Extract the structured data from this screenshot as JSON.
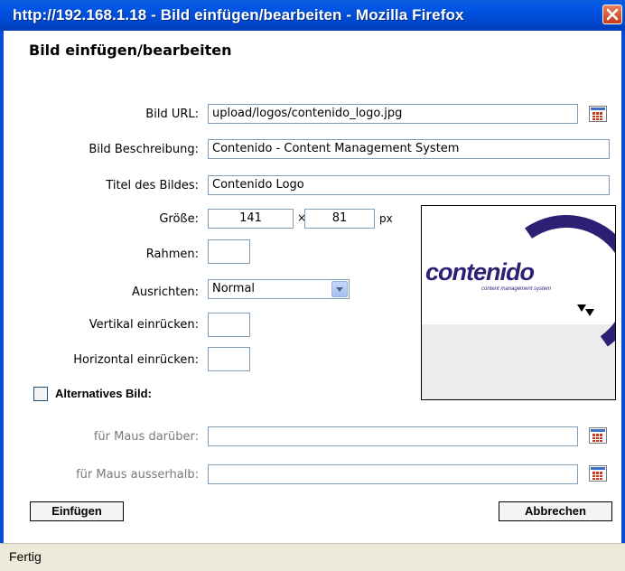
{
  "window": {
    "title": "http://192.168.1.18 - Bild einfügen/bearbeiten - Mozilla Firefox",
    "close_icon": "close-icon",
    "close_color": "#c7391b",
    "titlebar_color": "#0054e3"
  },
  "dialog": {
    "title": "Bild einfügen/bearbeiten",
    "fields": {
      "bild_url": {
        "label": "Bild URL:",
        "value": "upload/logos/contenido_logo.jpg"
      },
      "beschreibung": {
        "label": "Bild Beschreibung:",
        "value": "Contenido - Content Management System"
      },
      "titel": {
        "label": "Titel des Bildes:",
        "value": "Contenido Logo"
      },
      "groesse": {
        "label": "Größe:",
        "width": "141",
        "separator": "×",
        "height": "81",
        "unit": "px"
      },
      "rahmen": {
        "label": "Rahmen:",
        "value": ""
      },
      "ausrichten": {
        "label": "Ausrichten:",
        "selected": "Normal"
      },
      "vertikal": {
        "label": "Vertikal einrücken:",
        "value": ""
      },
      "horizontal": {
        "label": "Horizontal einrücken:",
        "value": ""
      }
    },
    "alternatives": {
      "checkbox_label": "Alternatives Bild:",
      "checked": false,
      "maus_darueber": {
        "label": "für Maus darüber:",
        "value": ""
      },
      "maus_ausserhalb": {
        "label": "für Maus ausserhalb:",
        "value": ""
      }
    },
    "preview": {
      "logo_text": "contenido",
      "logo_tagline": "content management system",
      "logo_color": "#2e1f74"
    },
    "buttons": {
      "insert": "Einfügen",
      "cancel": "Abbrechen"
    },
    "browse_icon": "browse-icon"
  },
  "statusbar": {
    "text": "Fertig"
  }
}
